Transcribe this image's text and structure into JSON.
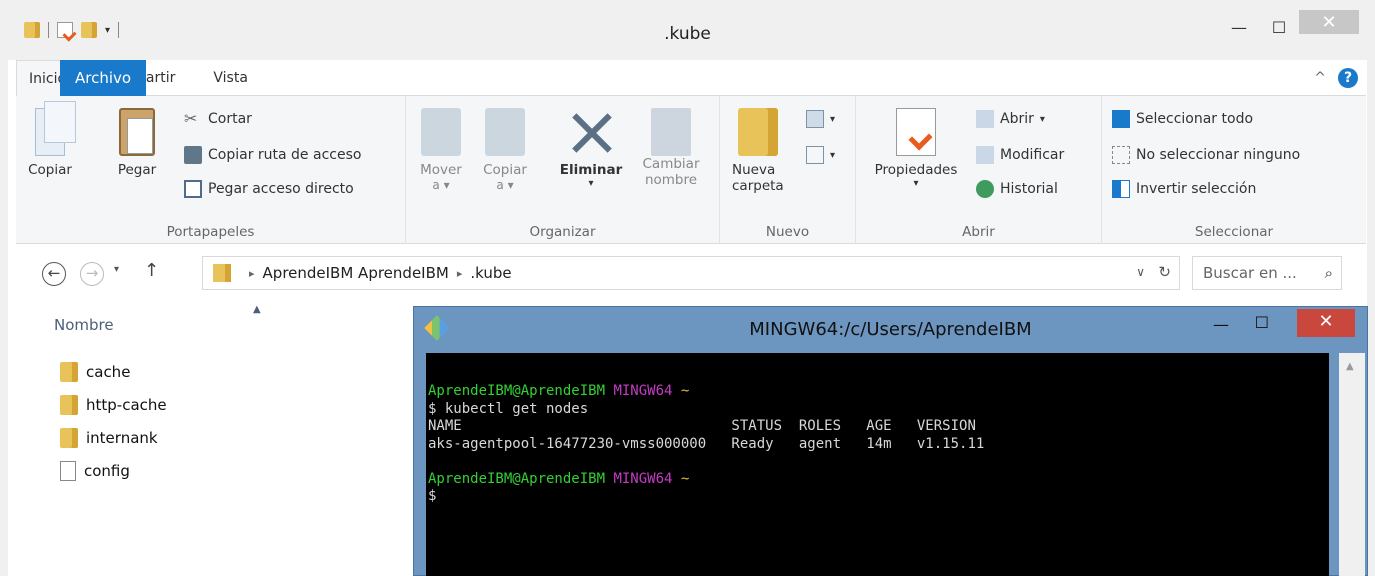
{
  "explorer": {
    "title": ".kube",
    "tabs": {
      "file": "Archivo",
      "home": "Inicio",
      "share": "Compartir",
      "view": "Vista"
    },
    "ribbon": {
      "clipboard": {
        "label": "Portapapeles",
        "copy": "Copiar",
        "paste": "Pegar",
        "cut": "Cortar",
        "copy_path": "Copiar ruta de acceso",
        "paste_shortcut": "Pegar acceso directo"
      },
      "organize": {
        "label": "Organizar",
        "move_to_1": "Mover",
        "move_to_2": "a",
        "copy_to_1": "Copiar",
        "copy_to_2": "a",
        "delete": "Eliminar",
        "rename_1": "Cambiar",
        "rename_2": "nombre"
      },
      "new": {
        "label": "Nuevo",
        "new_folder_1": "Nueva",
        "new_folder_2": "carpeta"
      },
      "open": {
        "label": "Abrir",
        "properties": "Propiedades",
        "open": "Abrir",
        "edit": "Modificar",
        "history": "Historial"
      },
      "select": {
        "label": "Seleccionar",
        "select_all": "Seleccionar todo",
        "select_none": "No seleccionar ninguno",
        "invert": "Invertir selección"
      }
    },
    "address": {
      "crumb1": "AprendeIBM AprendeIBM",
      "crumb2": ".kube",
      "search_placeholder": "Buscar en ..."
    },
    "list": {
      "column_name": "Nombre",
      "items": [
        {
          "name": "cache",
          "type": "folder"
        },
        {
          "name": "http-cache",
          "type": "folder"
        },
        {
          "name": "internank",
          "type": "folder"
        },
        {
          "name": "config",
          "type": "file"
        }
      ]
    }
  },
  "terminal": {
    "title": "MINGW64:/c/Users/AprendeIBM",
    "prompt_user": "AprendeIBM@AprendeIBM",
    "prompt_env": "MINGW64",
    "prompt_dir": "~",
    "command": "$ kubectl get nodes",
    "headers": [
      "NAME",
      "STATUS",
      "ROLES",
      "AGE",
      "VERSION"
    ],
    "row": [
      "aks-agentpool-16477230-vmss000000",
      "Ready",
      "agent",
      "14m",
      "v1.15.11"
    ],
    "cursor_prompt": "$"
  },
  "colors": {
    "accent": "#1979ca",
    "terminal_frame": "#6c95c0",
    "terminal_close": "#c9473d",
    "prompt_green": "#33d133",
    "prompt_magenta": "#c33cc3",
    "prompt_yellow": "#d4c43a"
  }
}
